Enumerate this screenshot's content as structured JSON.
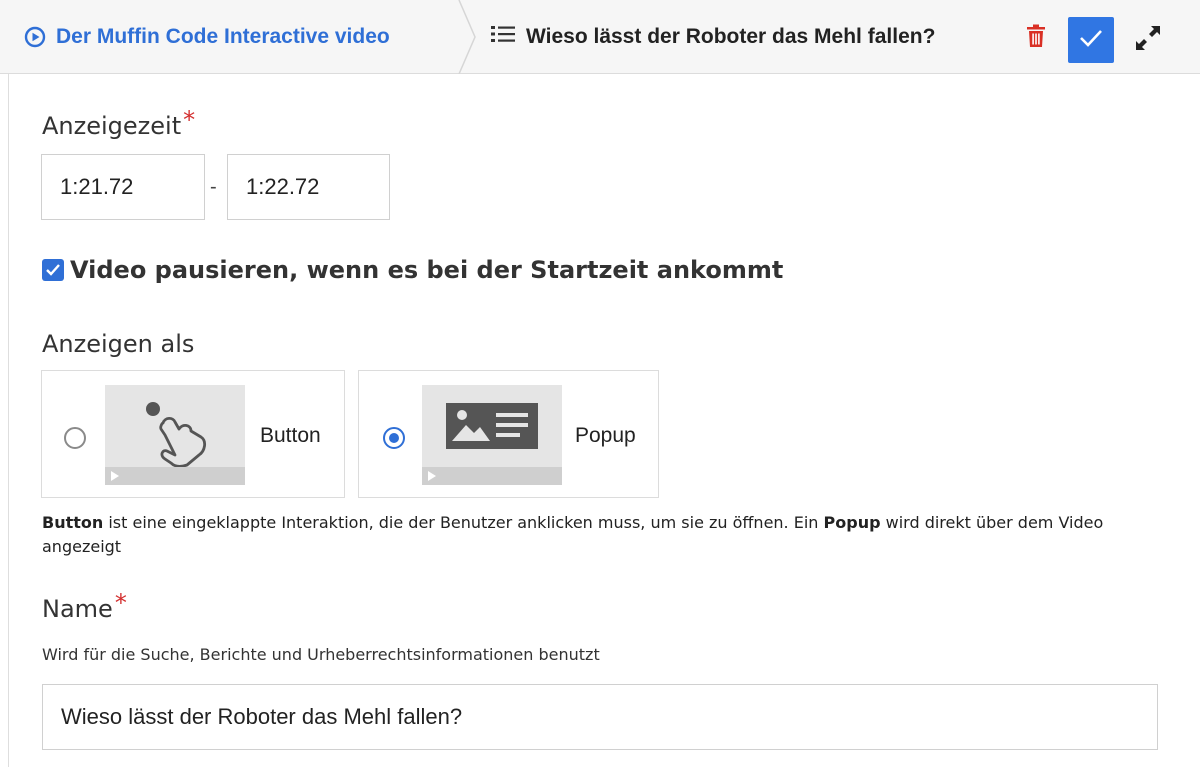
{
  "header": {
    "root_title": "Der Muffin Code Interactive video",
    "current_title": "Wieso lässt der Roboter das Mehl fallen?",
    "colors": {
      "accent": "#3076e3",
      "delete": "#d93025"
    }
  },
  "display_time": {
    "label": "Anzeigezeit",
    "required_mark": "*",
    "start": "1:21.72",
    "separator": "-",
    "end": "1:22.72"
  },
  "pause": {
    "checked": true,
    "label": "Video pausieren, wenn es bei der Startzeit ankommt"
  },
  "display_as": {
    "label": "Anzeigen als",
    "options": [
      {
        "label": "Button",
        "selected": false,
        "icon": "hand-tap-icon"
      },
      {
        "label": "Popup",
        "selected": true,
        "icon": "image-text-icon"
      }
    ],
    "help": {
      "term1": "Button",
      "part1": " ist eine eingeklappte Interaktion, die der Benutzer anklicken muss, um sie zu öffnen. Ein ",
      "term2": "Popup",
      "part2": " wird direkt über dem Video angezeigt"
    }
  },
  "name": {
    "label": "Name",
    "required_mark": "*",
    "help": "Wird für die Suche, Berichte und Urheberrechtsinformationen benutzt",
    "value": "Wieso lässt der Roboter das Mehl fallen?"
  }
}
